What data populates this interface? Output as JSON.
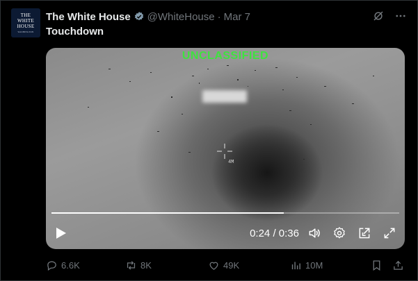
{
  "post": {
    "author_name": "The White House",
    "handle": "@WhiteHouse",
    "separator": "·",
    "date": "Mar 7",
    "text": "Touchdown",
    "avatar_text": [
      "THE",
      "WHITE",
      "HOUSE",
      "WASHINGTON"
    ]
  },
  "video": {
    "overlay_label": "UNCLASSIFIED",
    "range_readout": "4M",
    "current_time": "0:24",
    "duration": "0:36",
    "time_separator": "/",
    "progress_fraction": 0.667
  },
  "actions": {
    "replies": "6.6K",
    "reposts": "8K",
    "likes": "49K",
    "views": "10M"
  },
  "colors": {
    "overlay_green": "#3ee33e",
    "verified_badge": "#829aab",
    "muted_text": "#71767b"
  },
  "icons": [
    "verified-icon",
    "grok-icon",
    "more-icon",
    "play-icon",
    "volume-icon",
    "settings-icon",
    "pip-icon",
    "fullscreen-icon",
    "reply-icon",
    "repost-icon",
    "like-icon",
    "views-icon",
    "bookmark-icon",
    "share-icon"
  ]
}
